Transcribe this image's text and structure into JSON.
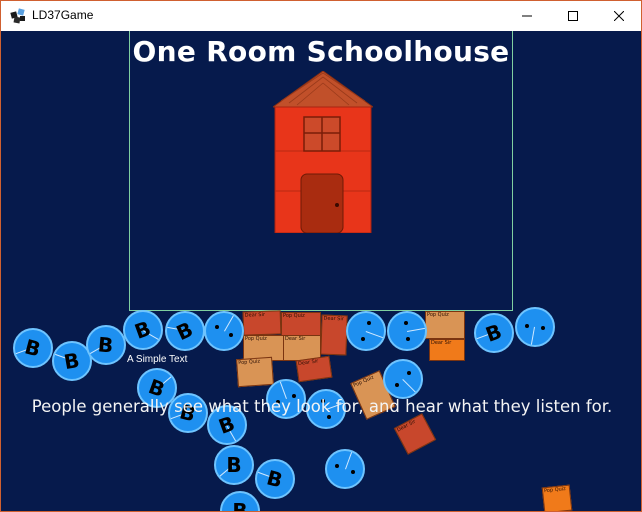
{
  "window": {
    "title": "LD37Game",
    "minimize_glyph": "—",
    "maximize_glyph": "☐",
    "close_glyph": "✕"
  },
  "game": {
    "title": "One Room Schoolhouse",
    "quote": "People generally see what they look for, and hear what they listen for.",
    "small_label": "A Simple Text",
    "ball_letter": "B",
    "book_word_1": "Dear Sir",
    "book_word_2": "Pop Quiz",
    "colors": {
      "background": "#061a4c",
      "frame": "#7fd0a0",
      "schoolhouse": "#e8351a",
      "roof": "#c1502a",
      "ball": "#1e90f0",
      "book_red": "#c8472c",
      "book_tan": "#d99455",
      "book_orange": "#f07a1a"
    }
  }
}
